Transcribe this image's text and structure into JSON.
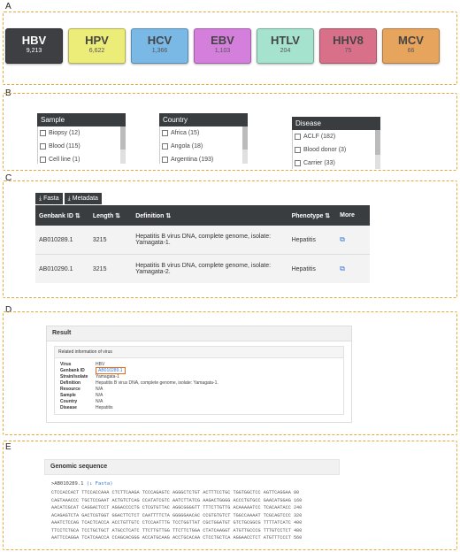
{
  "panels": {
    "a": "A",
    "b": "B",
    "c": "C",
    "d": "D",
    "e": "E"
  },
  "viruses": [
    {
      "name": "HBV",
      "count": "9,213",
      "color": "#3d3f42",
      "active": true
    },
    {
      "name": "HPV",
      "count": "6,622",
      "color": "#ecec78",
      "active": false
    },
    {
      "name": "HCV",
      "count": "1,366",
      "color": "#7ab8e6",
      "active": false
    },
    {
      "name": "EBV",
      "count": "1,103",
      "color": "#d47fdc",
      "active": false
    },
    {
      "name": "HTLV",
      "count": "204",
      "color": "#a6e3cf",
      "active": false
    },
    {
      "name": "HHV8",
      "count": "75",
      "color": "#d9708a",
      "active": false
    },
    {
      "name": "MCV",
      "count": "66",
      "color": "#e6a45c",
      "active": false
    }
  ],
  "filters": {
    "sample": {
      "title": "Sample",
      "items": [
        "Biopsy (12)",
        "Blood (115)",
        "Cell line (1)"
      ]
    },
    "country": {
      "title": "Country",
      "items": [
        "Africa (15)",
        "Angola (18)",
        "Argentina (193)"
      ]
    },
    "disease": {
      "title": "Disease",
      "items": [
        "ACLF (182)",
        "Blood donor (3)",
        "Carrier (33)"
      ]
    }
  },
  "download": {
    "fasta": "Fasta",
    "metadata": "Metadata"
  },
  "table": {
    "headers": [
      "Genbank ID ⇅",
      "Length ⇅",
      "Definition ⇅",
      "Phenotype ⇅",
      "More"
    ],
    "rows": [
      {
        "id": "AB010289.1",
        "length": "3215",
        "definition": "Hepatitis B virus DNA, complete genome, isolate: Yamagata-1.",
        "phenotype": "Hepatitis"
      },
      {
        "id": "AB010290.1",
        "length": "3215",
        "definition": "Hepatitis B virus DNA, complete genome, isolate: Yamagata-2.",
        "phenotype": "Hepatitis"
      }
    ]
  },
  "result": {
    "title": "Result",
    "info_title": "Related information of virus",
    "rows": [
      {
        "k": "Virus",
        "v": "HBV"
      },
      {
        "k": "Genbank ID",
        "v": "AB010289.1"
      },
      {
        "k": "Strain/isolate",
        "v": "Yamagata-1"
      },
      {
        "k": "Definition",
        "v": "Hepatitis B virus DNA, complete genome, isolate: Yamagata-1."
      },
      {
        "k": "Resource",
        "v": "N/A"
      },
      {
        "k": "Sample",
        "v": "N/A"
      },
      {
        "k": "Country",
        "v": "N/A"
      },
      {
        "k": "Disease",
        "v": "Hepatitis"
      }
    ]
  },
  "genomic": {
    "title": "Genomic sequence",
    "header_id": ">AB010289.1",
    "header_link": "(↓ Fasta)",
    "lines": [
      "CTCCACCACT TTCCACCAAA CTCTTCAAGA TCCCAGAGTC AGGGCTCTGT ACTTTCCTGC TGGTGGCTCC AGTTCAGGAA 80",
      "CAGTAAACCC TGCTCCGAAT ACTGTCTCAG CCATATCGTC AATCTTATCG AAGACTGGGG ACCCTGTGCC GAACATGGAG 160",
      "AACATCGCAT CAGGACTCCT AGGACCCCTG CTCGTGTTAC AGGCGGGGTT TTTCTTGTTG ACAAAAATCC TCACAATACC 240",
      "ACAGAGTCTA GACTCGTGGT GGACTTCTCT CAATTTTCTA GGGGGAACAC CCGTGTGTCT TGGCCAAAAT TCGCAGTCCC 320",
      "AAATCTCCAG TCACTCACCA ACCTGTTGTC CTCCAATTTG TCCTGGTTAT CGCTGGATGT GTCTGCGGCG TTTTATCATC 400",
      "TTCCTCTGCA TCCTGCTGCT ATGCCTCATC TTCTTGTTGG TTCTTCTGGA CTATCAAGGT ATGTTGCCCG TTTGTCCTCT 480",
      "AATTCCAGGA TCATCAACCA CCAGCACGGG ACCATGCAAG ACCTGCACAA CTCCTGCTCA AGGAACCTCT ATGTTTCCCT 560"
    ]
  }
}
